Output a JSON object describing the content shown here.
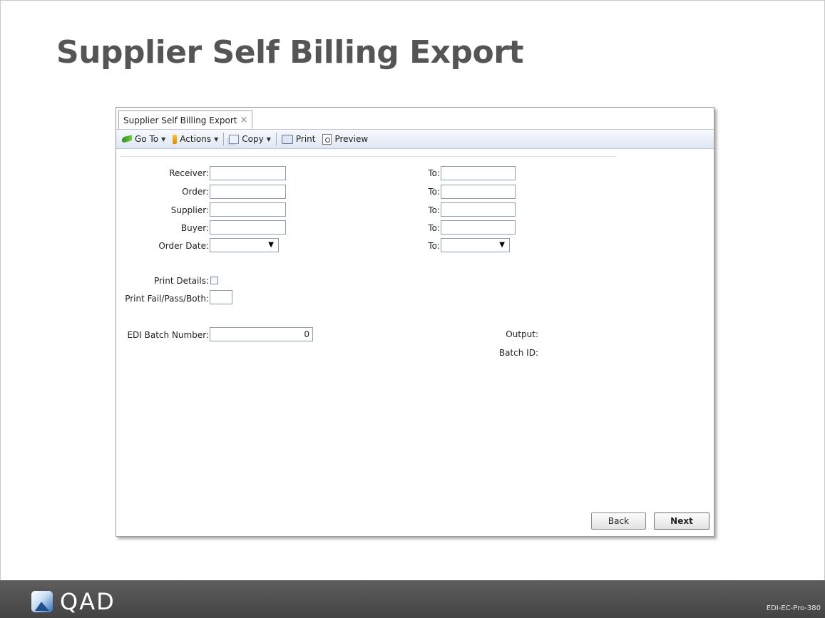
{
  "slide": {
    "title": "Supplier Self Billing Export",
    "code": "EDI-EC-Pro-380",
    "logo_text": "QAD"
  },
  "window": {
    "tab_label": "Supplier Self Billing Export",
    "tab_close": "×"
  },
  "toolbar": {
    "goto": "Go To",
    "actions": "Actions",
    "copy": "Copy",
    "print": "Print",
    "preview": "Preview",
    "caret": "▼"
  },
  "form": {
    "receiver_label": "Receiver:",
    "order_label": "Order:",
    "supplier_label": "Supplier:",
    "buyer_label": "Buyer:",
    "order_date_label": "Order Date:",
    "to_label": "To:",
    "print_details_label": "Print Details:",
    "print_fail_label": "Print Fail/Pass/Both:",
    "edi_batch_label": "EDI Batch Number:",
    "edi_batch_value": "0",
    "output_label": "Output:",
    "batch_id_label": "Batch ID:",
    "dropdown_arrow": "▼",
    "print_details_checked": false
  },
  "buttons": {
    "back": "Back",
    "next": "Next"
  }
}
